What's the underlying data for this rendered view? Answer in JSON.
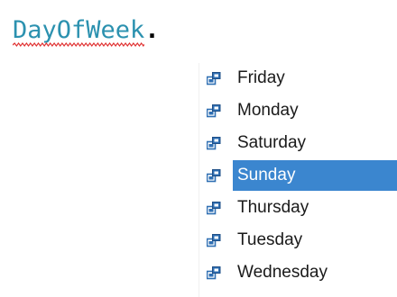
{
  "editor": {
    "code": {
      "type_name": "DayOfWeek",
      "member_access": "."
    }
  },
  "completion": {
    "item_icon": "enum-member-icon",
    "selected_index": 3,
    "items": [
      {
        "label": "Friday"
      },
      {
        "label": "Monday"
      },
      {
        "label": "Saturday"
      },
      {
        "label": "Sunday"
      },
      {
        "label": "Thursday"
      },
      {
        "label": "Tuesday"
      },
      {
        "label": "Wednesday"
      }
    ]
  },
  "colors": {
    "type_name": "#2b91af",
    "error_squiggle": "#e03030",
    "selection": "#3b86cf",
    "icon_blue": "#2f6fb3"
  }
}
